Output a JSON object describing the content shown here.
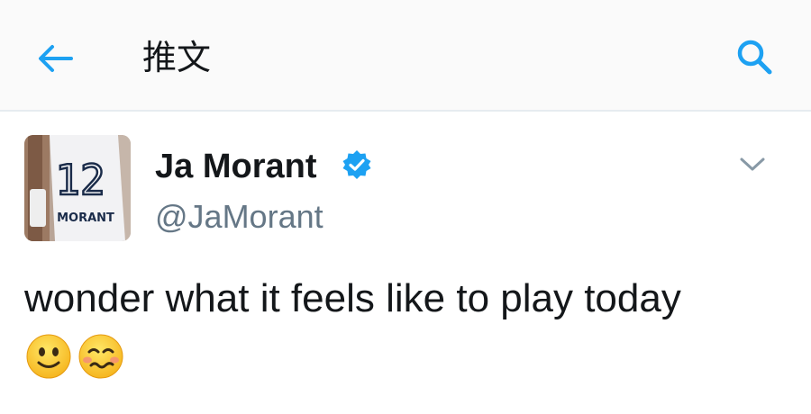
{
  "header": {
    "title": "推文",
    "back_icon": "arrow-left-icon",
    "search_icon": "search-icon",
    "accent_color": "#1da1f2"
  },
  "tweet": {
    "author_name": "Ja Morant",
    "author_handle": "@JaMorant",
    "verified": true,
    "avatar": {
      "jersey_number": "12",
      "jersey_name": "MORANT"
    },
    "text": "wonder what it feels like to play today",
    "emojis": [
      "slightly-smiling-face-icon",
      "woozy-face-icon"
    ]
  }
}
